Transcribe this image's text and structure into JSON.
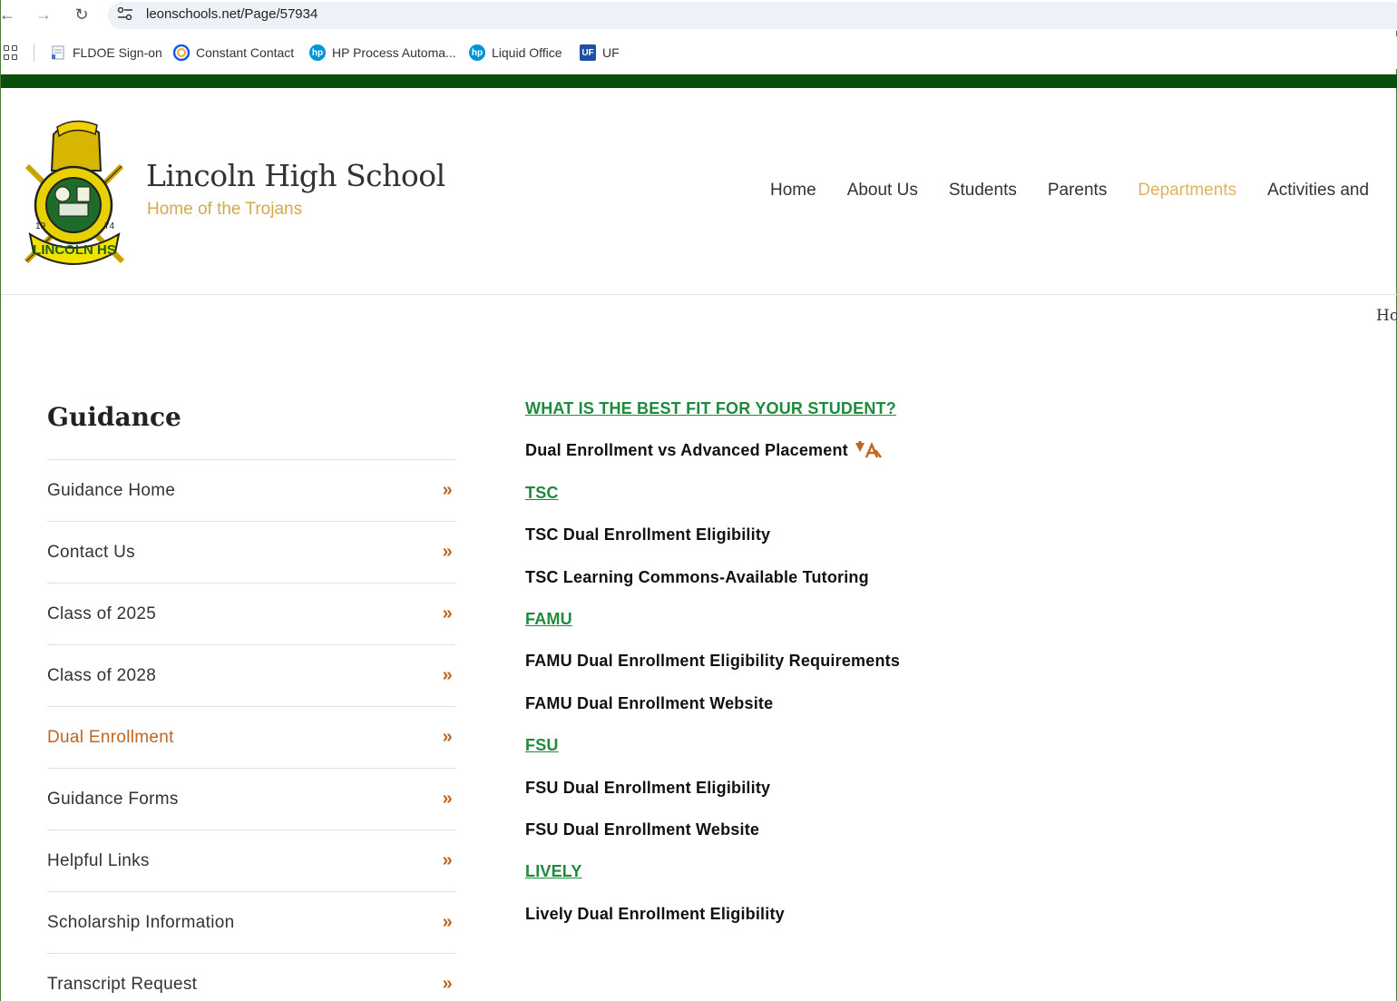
{
  "browser": {
    "url": "leonschools.net/Page/57934",
    "bookmarks": [
      {
        "label": "FLDOE Sign-on",
        "icon": "document-icon"
      },
      {
        "label": "Constant Contact",
        "icon": "constant-contact-icon"
      },
      {
        "label": "HP Process Automa...",
        "icon": "hp-icon"
      },
      {
        "label": "Liquid Office",
        "icon": "hp-icon"
      },
      {
        "label": "UF",
        "icon": "uf-icon"
      }
    ]
  },
  "header": {
    "title": "Lincoln High School",
    "subtitle": "Home of the Trojans",
    "logo_text": "LINCOLN HS",
    "nav": [
      "Home",
      "About Us",
      "Students",
      "Parents",
      "Departments",
      "Activities and"
    ],
    "active_nav": "Departments",
    "breadcrumb": "Ho"
  },
  "sidebar": {
    "title": "Guidance",
    "items": [
      {
        "label": "Guidance Home"
      },
      {
        "label": "Contact Us"
      },
      {
        "label": "Class of 2025"
      },
      {
        "label": "Class of 2028"
      },
      {
        "label": "Dual Enrollment",
        "active": true
      },
      {
        "label": "Guidance Forms"
      },
      {
        "label": "Helpful Links"
      },
      {
        "label": "Scholarship Information"
      },
      {
        "label": "Transcript Request"
      }
    ],
    "chevron": "»"
  },
  "content": {
    "lines": [
      {
        "text": "WHAT IS THE BEST FIT FOR YOUR STUDENT?",
        "type": "heading"
      },
      {
        "text": "Dual Enrollment vs Advanced Placement",
        "type": "link",
        "icon": "translate-icon"
      },
      {
        "text": "TSC",
        "type": "heading"
      },
      {
        "text": "TSC Dual Enrollment Eligibility",
        "type": "link"
      },
      {
        "text": "TSC Learning Commons-Available Tutoring",
        "type": "link"
      },
      {
        "text": "FAMU",
        "type": "heading"
      },
      {
        "text": "FAMU Dual Enrollment Eligibility Requirements",
        "type": "link"
      },
      {
        "text": "FAMU Dual Enrollment Website",
        "type": "link"
      },
      {
        "text": "FSU",
        "type": "heading"
      },
      {
        "text": "FSU Dual Enrollment Eligibility",
        "type": "link"
      },
      {
        "text": "FSU Dual Enrollment Website",
        "type": "link"
      },
      {
        "text": "LIVELY",
        "type": "heading"
      },
      {
        "text": "Lively Dual Enrollment Eligibility",
        "type": "link"
      }
    ]
  },
  "colors": {
    "brand_green": "#0b4d0b",
    "heading_green": "#1e8a3c",
    "accent_gold": "#d4a84b",
    "accent_orange": "#c0651f"
  }
}
